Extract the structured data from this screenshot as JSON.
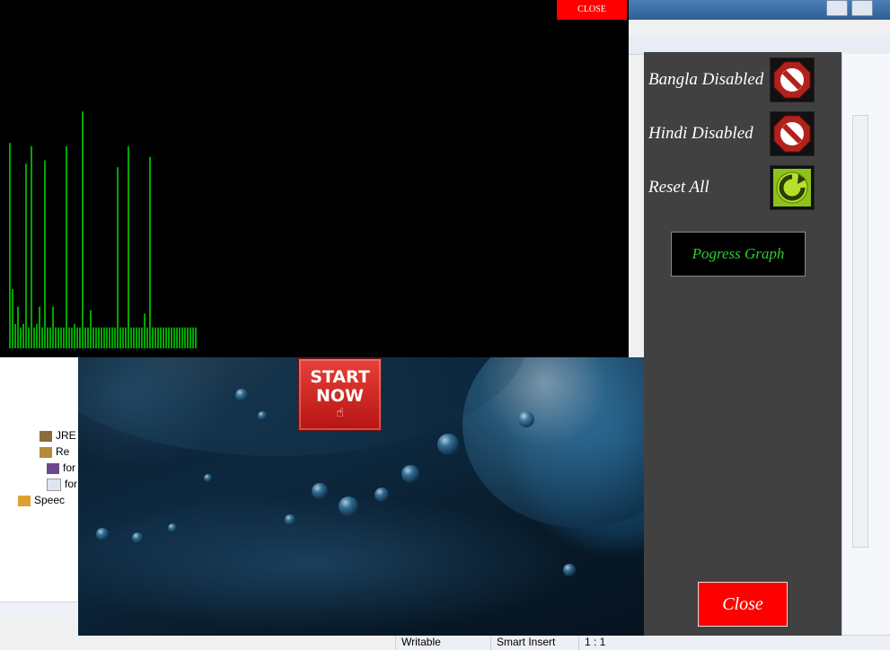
{
  "ide": {
    "tree_items": [
      "JRE",
      "Re",
      "for",
      "for",
      "Speec"
    ],
    "status": {
      "writable": "Writable",
      "insert_mode": "Smart Insert",
      "position": "1 : 1"
    }
  },
  "graph_window": {
    "close_label": "CLOSE",
    "levels": [
      0.59,
      0.17,
      0.07,
      0.12,
      0.06,
      0.07,
      0.53,
      0.06,
      0.58,
      0.06,
      0.07,
      0.12,
      0.06,
      0.54,
      0.06,
      0.06,
      0.12,
      0.06,
      0.06,
      0.06,
      0.06,
      0.58,
      0.06,
      0.06,
      0.07,
      0.06,
      0.06,
      0.68,
      0.06,
      0.06,
      0.11,
      0.06,
      0.06,
      0.06,
      0.06,
      0.06,
      0.06,
      0.06,
      0.06,
      0.06,
      0.52,
      0.06,
      0.06,
      0.06,
      0.58,
      0.06,
      0.06,
      0.06,
      0.06,
      0.06,
      0.1,
      0.06,
      0.55,
      0.06,
      0.06,
      0.06,
      0.06,
      0.06,
      0.06,
      0.06,
      0.06,
      0.06,
      0.06,
      0.06,
      0.06,
      0.06,
      0.06,
      0.06,
      0.06,
      0.06
    ]
  },
  "app": {
    "start_button": {
      "line1": "START",
      "line2": "NOW"
    },
    "panel": {
      "bangla_label": "Bangla Disabled",
      "hindi_label": "Hindi Disabled",
      "reset_label": "Reset All",
      "progress_label": "Pogress Graph",
      "close_label": "Close"
    }
  },
  "colors": {
    "graph_line": "#00d000",
    "panel_bg": "#414141",
    "close_red": "#ff0000",
    "progress_text": "#2ecc2e"
  },
  "icons": {
    "bangla": "no-entry-icon",
    "hindi": "no-entry-icon",
    "reset": "refresh-icon",
    "start": "hand-pointer-icon"
  }
}
